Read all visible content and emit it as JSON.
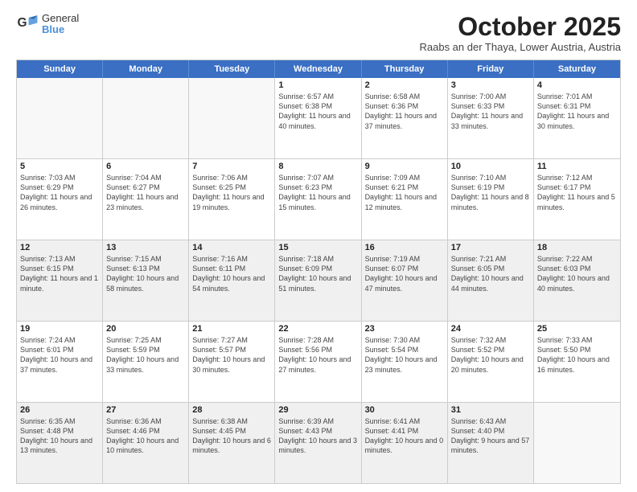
{
  "logo": {
    "general": "General",
    "blue": "Blue"
  },
  "title": "October 2025",
  "location": "Raabs an der Thaya, Lower Austria, Austria",
  "weekdays": [
    "Sunday",
    "Monday",
    "Tuesday",
    "Wednesday",
    "Thursday",
    "Friday",
    "Saturday"
  ],
  "rows": [
    [
      {
        "day": "",
        "info": "",
        "empty": true
      },
      {
        "day": "",
        "info": "",
        "empty": true
      },
      {
        "day": "",
        "info": "",
        "empty": true
      },
      {
        "day": "1",
        "info": "Sunrise: 6:57 AM\nSunset: 6:38 PM\nDaylight: 11 hours\nand 40 minutes."
      },
      {
        "day": "2",
        "info": "Sunrise: 6:58 AM\nSunset: 6:36 PM\nDaylight: 11 hours\nand 37 minutes."
      },
      {
        "day": "3",
        "info": "Sunrise: 7:00 AM\nSunset: 6:33 PM\nDaylight: 11 hours\nand 33 minutes."
      },
      {
        "day": "4",
        "info": "Sunrise: 7:01 AM\nSunset: 6:31 PM\nDaylight: 11 hours\nand 30 minutes."
      }
    ],
    [
      {
        "day": "5",
        "info": "Sunrise: 7:03 AM\nSunset: 6:29 PM\nDaylight: 11 hours\nand 26 minutes."
      },
      {
        "day": "6",
        "info": "Sunrise: 7:04 AM\nSunset: 6:27 PM\nDaylight: 11 hours\nand 23 minutes."
      },
      {
        "day": "7",
        "info": "Sunrise: 7:06 AM\nSunset: 6:25 PM\nDaylight: 11 hours\nand 19 minutes."
      },
      {
        "day": "8",
        "info": "Sunrise: 7:07 AM\nSunset: 6:23 PM\nDaylight: 11 hours\nand 15 minutes."
      },
      {
        "day": "9",
        "info": "Sunrise: 7:09 AM\nSunset: 6:21 PM\nDaylight: 11 hours\nand 12 minutes."
      },
      {
        "day": "10",
        "info": "Sunrise: 7:10 AM\nSunset: 6:19 PM\nDaylight: 11 hours\nand 8 minutes."
      },
      {
        "day": "11",
        "info": "Sunrise: 7:12 AM\nSunset: 6:17 PM\nDaylight: 11 hours\nand 5 minutes."
      }
    ],
    [
      {
        "day": "12",
        "info": "Sunrise: 7:13 AM\nSunset: 6:15 PM\nDaylight: 11 hours\nand 1 minute.",
        "shaded": true
      },
      {
        "day": "13",
        "info": "Sunrise: 7:15 AM\nSunset: 6:13 PM\nDaylight: 10 hours\nand 58 minutes.",
        "shaded": true
      },
      {
        "day": "14",
        "info": "Sunrise: 7:16 AM\nSunset: 6:11 PM\nDaylight: 10 hours\nand 54 minutes.",
        "shaded": true
      },
      {
        "day": "15",
        "info": "Sunrise: 7:18 AM\nSunset: 6:09 PM\nDaylight: 10 hours\nand 51 minutes.",
        "shaded": true
      },
      {
        "day": "16",
        "info": "Sunrise: 7:19 AM\nSunset: 6:07 PM\nDaylight: 10 hours\nand 47 minutes.",
        "shaded": true
      },
      {
        "day": "17",
        "info": "Sunrise: 7:21 AM\nSunset: 6:05 PM\nDaylight: 10 hours\nand 44 minutes.",
        "shaded": true
      },
      {
        "day": "18",
        "info": "Sunrise: 7:22 AM\nSunset: 6:03 PM\nDaylight: 10 hours\nand 40 minutes.",
        "shaded": true
      }
    ],
    [
      {
        "day": "19",
        "info": "Sunrise: 7:24 AM\nSunset: 6:01 PM\nDaylight: 10 hours\nand 37 minutes."
      },
      {
        "day": "20",
        "info": "Sunrise: 7:25 AM\nSunset: 5:59 PM\nDaylight: 10 hours\nand 33 minutes."
      },
      {
        "day": "21",
        "info": "Sunrise: 7:27 AM\nSunset: 5:57 PM\nDaylight: 10 hours\nand 30 minutes."
      },
      {
        "day": "22",
        "info": "Sunrise: 7:28 AM\nSunset: 5:56 PM\nDaylight: 10 hours\nand 27 minutes."
      },
      {
        "day": "23",
        "info": "Sunrise: 7:30 AM\nSunset: 5:54 PM\nDaylight: 10 hours\nand 23 minutes."
      },
      {
        "day": "24",
        "info": "Sunrise: 7:32 AM\nSunset: 5:52 PM\nDaylight: 10 hours\nand 20 minutes."
      },
      {
        "day": "25",
        "info": "Sunrise: 7:33 AM\nSunset: 5:50 PM\nDaylight: 10 hours\nand 16 minutes."
      }
    ],
    [
      {
        "day": "26",
        "info": "Sunrise: 6:35 AM\nSunset: 4:48 PM\nDaylight: 10 hours\nand 13 minutes.",
        "shaded": true
      },
      {
        "day": "27",
        "info": "Sunrise: 6:36 AM\nSunset: 4:46 PM\nDaylight: 10 hours\nand 10 minutes.",
        "shaded": true
      },
      {
        "day": "28",
        "info": "Sunrise: 6:38 AM\nSunset: 4:45 PM\nDaylight: 10 hours\nand 6 minutes.",
        "shaded": true
      },
      {
        "day": "29",
        "info": "Sunrise: 6:39 AM\nSunset: 4:43 PM\nDaylight: 10 hours\nand 3 minutes.",
        "shaded": true
      },
      {
        "day": "30",
        "info": "Sunrise: 6:41 AM\nSunset: 4:41 PM\nDaylight: 10 hours\nand 0 minutes.",
        "shaded": true
      },
      {
        "day": "31",
        "info": "Sunrise: 6:43 AM\nSunset: 4:40 PM\nDaylight: 9 hours\nand 57 minutes.",
        "shaded": true
      },
      {
        "day": "",
        "info": "",
        "empty": true,
        "shaded": true
      }
    ]
  ]
}
